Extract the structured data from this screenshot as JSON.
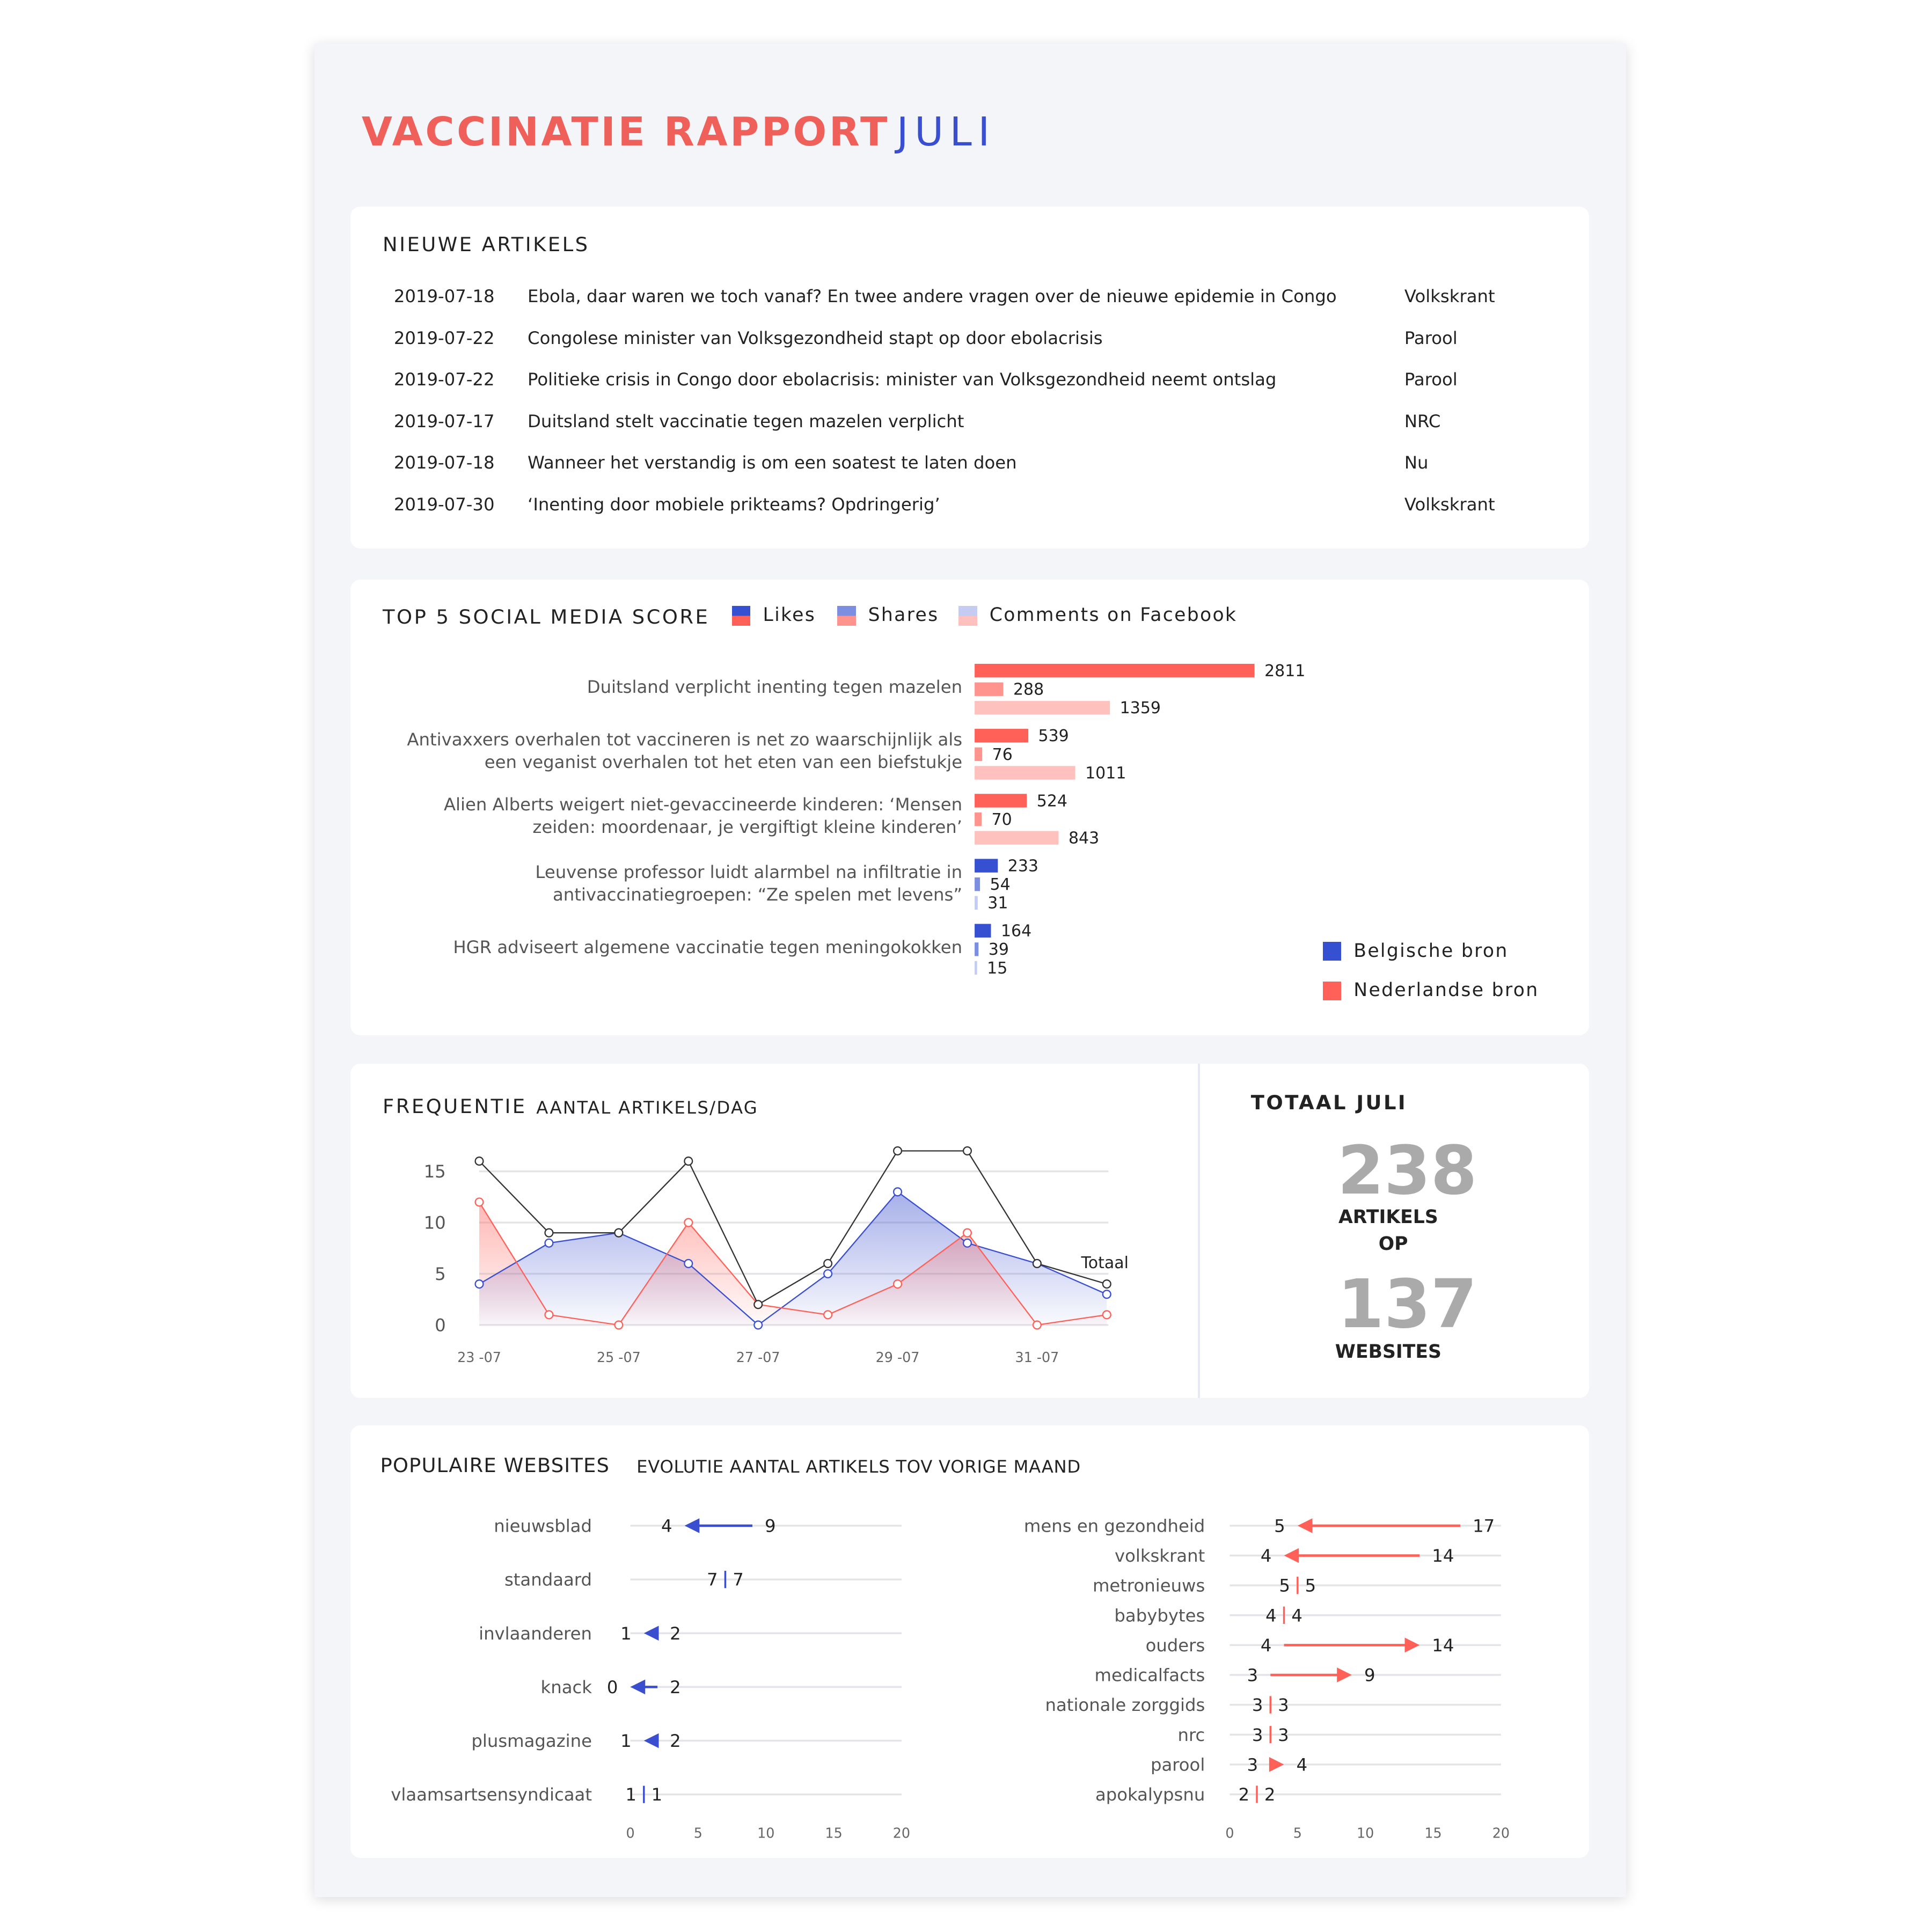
{
  "header": {
    "title": "VACCINATIE RAPPORT",
    "month": "JULI"
  },
  "articles": {
    "title": "NIEUWE ARTIKELS",
    "rows": [
      {
        "date": "2019-07-18",
        "title": "Ebola, daar waren we toch vanaf? En twee andere vragen over de nieuwe epidemie in Congo",
        "source": "Volkskrant"
      },
      {
        "date": "2019-07-22",
        "title": "Congolese minister van Volksgezondheid stapt op door ebolacrisis",
        "source": "Parool"
      },
      {
        "date": "2019-07-22",
        "title": "Politieke crisis in Congo door ebolacrisis: minister van Volksgezondheid neemt ontslag",
        "source": "Parool"
      },
      {
        "date": "2019-07-17",
        "title": "Duitsland stelt vaccinatie tegen mazelen verplicht",
        "source": "NRC"
      },
      {
        "date": "2019-07-18",
        "title": "Wanneer het verstandig is om een soatest te laten doen",
        "source": "Nu"
      },
      {
        "date": "2019-07-30",
        "title": "‘Inenting door mobiele prikteams? Opdringerig’",
        "source": "Volkskrant"
      }
    ]
  },
  "chart_data": [
    {
      "type": "bar",
      "title": "TOP 5 SOCIAL MEDIA SCORE",
      "legend": [
        "Likes",
        "Shares",
        "Comments on Facebook"
      ],
      "source_legend": [
        "Belgische bron",
        "Nederlandse bron"
      ],
      "colors": {
        "belgian": [
          "#3550d0",
          "#7b8ee0",
          "#c5ccf2"
        ],
        "dutch": [
          "#ff6058",
          "#ff948e",
          "#ffc1bd"
        ]
      },
      "categories": [
        "Duitsland verplicht inenting tegen mazelen",
        "Antivaxxers overhalen tot vaccineren is net zo waarschijnlijk als een veganist overhalen tot het eten van een biefstukje",
        "Alien Alberts weigert niet-gevaccineerde kinderen: ‘Mensen zeiden: moordenaar, je vergiftigt kleine kinderen’",
        "Leuvense professor luidt alarmbel na infiltratie in antivaccinatiegroepen: “Ze spelen met levens”",
        "HGR adviseert algemene vaccinatie tegen meningokokken"
      ],
      "source": [
        "Nederlandse bron",
        "Nederlandse bron",
        "Nederlandse bron",
        "Belgische bron",
        "Belgische bron"
      ],
      "series": [
        {
          "name": "Likes",
          "values": [
            2811,
            539,
            524,
            233,
            164
          ]
        },
        {
          "name": "Shares",
          "values": [
            288,
            76,
            70,
            54,
            39
          ]
        },
        {
          "name": "Comments on Facebook",
          "values": [
            1359,
            1011,
            843,
            31,
            15
          ]
        }
      ]
    },
    {
      "type": "line",
      "title": "FREQUENTIE",
      "subtitle": "AANTAL ARTIKELS/DAG",
      "x": [
        "23-07",
        "24-07",
        "25-07",
        "26-07",
        "27-07",
        "28-07",
        "29-07",
        "30-07",
        "31-07",
        "01-08"
      ],
      "xtick_labels": [
        "23 -07",
        "25 -07",
        "27 -07",
        "29 -07",
        "31 -07"
      ],
      "yticks": [
        0,
        5,
        10,
        15
      ],
      "ylim": [
        0,
        17
      ],
      "grid": true,
      "series": [
        {
          "name": "Totaal",
          "color": "#333333",
          "values": [
            16,
            9,
            9,
            16,
            2,
            6,
            17,
            17,
            6,
            4
          ]
        },
        {
          "color": "#3a4fcf",
          "values": [
            4,
            8,
            9,
            6,
            0,
            5,
            13,
            8,
            6,
            3
          ]
        },
        {
          "color": "#ff6058",
          "values": [
            12,
            1,
            0,
            10,
            2,
            1,
            4,
            9,
            0,
            1
          ]
        }
      ]
    },
    {
      "type": "dumbbell",
      "title": "POPULAIRE WEBSITES",
      "subtitle": "EVOLUTIE AANTAL ARTIKELS TOV VORIGE MAAND",
      "xlim": [
        0,
        20
      ],
      "xticks": [
        0,
        5,
        10,
        15,
        20
      ],
      "color": "#3a4fcf",
      "rows": [
        {
          "site": "nieuwsblad",
          "previous": 9,
          "current": 4
        },
        {
          "site": "standaard",
          "previous": 7,
          "current": 7
        },
        {
          "site": "invlaanderen",
          "previous": 2,
          "current": 1
        },
        {
          "site": "knack",
          "previous": 2,
          "current": 0
        },
        {
          "site": "plusmagazine",
          "previous": 2,
          "current": 1
        },
        {
          "site": "vlaamsartsensyndicaat",
          "previous": 1,
          "current": 1
        }
      ]
    },
    {
      "type": "dumbbell",
      "xlim": [
        0,
        20
      ],
      "xticks": [
        0,
        5,
        10,
        15,
        20
      ],
      "color": "#ff6058",
      "rows": [
        {
          "site": "mens en gezondheid",
          "previous": 17,
          "current": 5
        },
        {
          "site": "volkskrant",
          "previous": 14,
          "current": 4
        },
        {
          "site": "metronieuws",
          "previous": 5,
          "current": 5
        },
        {
          "site": "babybytes",
          "previous": 4,
          "current": 4
        },
        {
          "site": "ouders",
          "previous": 4,
          "current": 14
        },
        {
          "site": "medicalfacts",
          "previous": 3,
          "current": 9
        },
        {
          "site": "nationale zorggids",
          "previous": 3,
          "current": 3
        },
        {
          "site": "nrc",
          "previous": 3,
          "current": 3
        },
        {
          "site": "parool",
          "previous": 3,
          "current": 4
        },
        {
          "site": "apokalypsnu",
          "previous": 2,
          "current": 2
        }
      ]
    }
  ],
  "totals": {
    "title": "TOTAAL JULI",
    "articles": "238",
    "articles_label": "ARTIKELS",
    "op": "OP",
    "websites": "137",
    "websites_label": "WEBSITES"
  }
}
